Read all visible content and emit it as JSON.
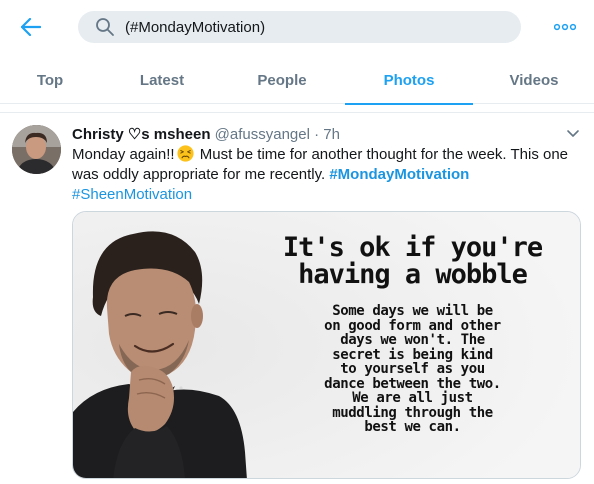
{
  "search": {
    "value": "(#MondayMotivation)"
  },
  "icons": {
    "back": "arrow-left-icon",
    "search": "magnifier-icon",
    "more": "more-dots-icon",
    "caret": "chevron-down-icon"
  },
  "tabs": [
    {
      "label": "Top",
      "active": false
    },
    {
      "label": "Latest",
      "active": false
    },
    {
      "label": "People",
      "active": false
    },
    {
      "label": "Photos",
      "active": true
    },
    {
      "label": "Videos",
      "active": false
    }
  ],
  "tweet": {
    "name": "Christy ♡s msheen",
    "handle": "@afussyangel",
    "separator": "·",
    "time": "7h",
    "text_part1": "Monday again!!",
    "text_part2": " Must be time for another thought for the week. This one was oddly appropriate for me recently. ",
    "hashtag1": "#MondayMotivation",
    "hashtag2": "#SheenMotivation",
    "image": {
      "title_line1": "It's ok if you're",
      "title_line2": "having a wobble",
      "body_lines": [
        "Some days we will be",
        "on good form and other",
        "days we won't. The",
        "secret is being kind",
        "to yourself as you",
        "dance between the two.",
        "We are all just",
        "muddling through the",
        "best we can."
      ]
    }
  },
  "colors": {
    "accent": "#1da1f2",
    "hashtag": "#1b95e0",
    "secondary_text": "#657786",
    "search_bg": "#e6ecf0"
  }
}
